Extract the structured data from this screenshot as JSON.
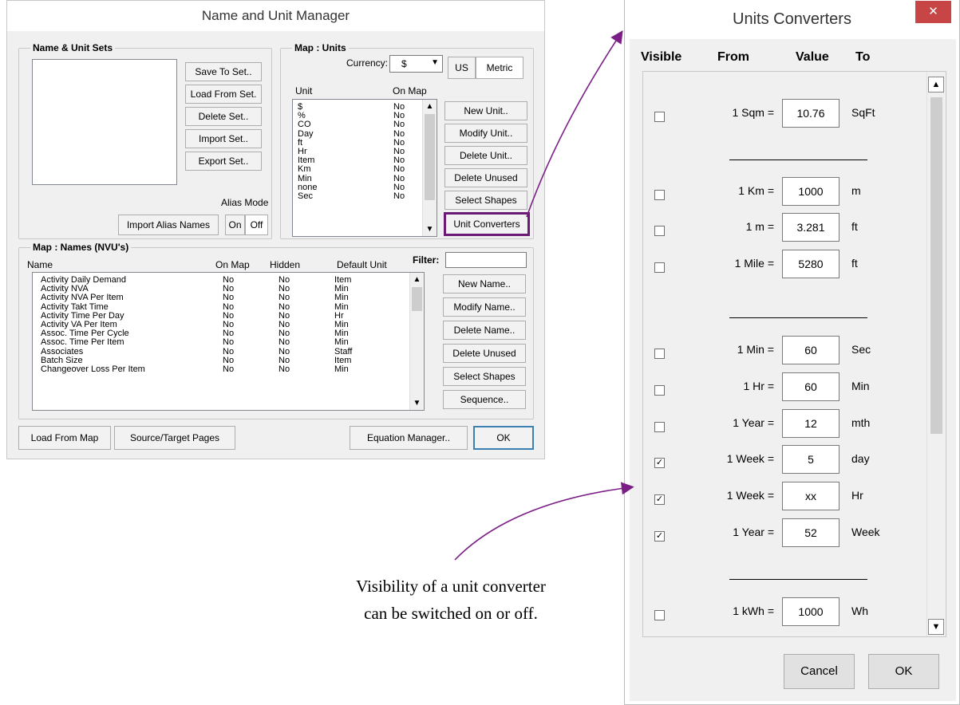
{
  "manager": {
    "title": "Name and Unit Manager",
    "sets": {
      "legend": "Name & Unit Sets",
      "buttons": [
        "Save To Set..",
        "Load From Set.",
        "Delete Set..",
        "Import Set..",
        "Export Set.."
      ],
      "alias_mode_label": "Alias Mode",
      "import_alias": "Import Alias Names",
      "on": "On",
      "off": "Off"
    },
    "units": {
      "legend": "Map : Units",
      "currency_label": "Currency:",
      "currency_value": "$",
      "us": "US",
      "metric": "Metric",
      "col_unit": "Unit",
      "col_onmap": "On Map",
      "rows": [
        [
          "$",
          "No"
        ],
        [
          "%",
          "No"
        ],
        [
          "CO",
          "No"
        ],
        [
          "Day",
          "No"
        ],
        [
          "ft",
          "No"
        ],
        [
          "Hr",
          "No"
        ],
        [
          "Item",
          "No"
        ],
        [
          "Km",
          "No"
        ],
        [
          "Min",
          "No"
        ],
        [
          "none",
          "No"
        ],
        [
          "Sec",
          "No"
        ]
      ],
      "buttons": [
        "New Unit..",
        "Modify Unit..",
        "Delete Unit..",
        "Delete Unused",
        "Select Shapes",
        "Unit Converters"
      ]
    },
    "names": {
      "legend": "Map : Names (NVU's)",
      "col_name": "Name",
      "col_onmap": "On Map",
      "col_hidden": "Hidden",
      "col_default": "Default Unit",
      "filter_label": "Filter:",
      "filter_value": "",
      "rows": [
        [
          "Activity Daily Demand",
          "No",
          "No",
          "Item"
        ],
        [
          "Activity NVA",
          "No",
          "No",
          "Min"
        ],
        [
          "Activity NVA Per Item",
          "No",
          "No",
          "Min"
        ],
        [
          "Activity Takt Time",
          "No",
          "No",
          "Min"
        ],
        [
          "Activity Time Per Day",
          "No",
          "No",
          "Hr"
        ],
        [
          "Activity VA Per Item",
          "No",
          "No",
          "Min"
        ],
        [
          "Assoc. Time Per Cycle",
          "No",
          "No",
          "Min"
        ],
        [
          "Assoc. Time Per Item",
          "No",
          "No",
          "Min"
        ],
        [
          "Associates",
          "No",
          "No",
          "Staff"
        ],
        [
          "Batch Size",
          "No",
          "No",
          "Item"
        ],
        [
          "Changeover Loss Per Item",
          "No",
          "No",
          "Min"
        ]
      ],
      "buttons": [
        "New Name..",
        "Modify Name..",
        "Delete Name..",
        "Delete Unused",
        "Select Shapes",
        "Sequence.."
      ]
    },
    "bottom": {
      "load_from_map": "Load From Map",
      "source_target": "Source/Target Pages",
      "equation_manager": "Equation Manager..",
      "ok": "OK"
    }
  },
  "converters": {
    "title": "Units Converters",
    "close": "✕",
    "headers": {
      "visible": "Visible",
      "from": "From",
      "value": "Value",
      "to": "To"
    },
    "rows": [
      {
        "from": "1 Sqm =",
        "value": "10.76",
        "to": "SqFt",
        "checked": false
      },
      {
        "from": "1 Km =",
        "value": "1000",
        "to": "m",
        "checked": false
      },
      {
        "from": "1 m =",
        "value": "3.281",
        "to": "ft",
        "checked": false
      },
      {
        "from": "1 Mile =",
        "value": "5280",
        "to": "ft",
        "checked": false
      },
      {
        "from": "1 Min =",
        "value": "60",
        "to": "Sec",
        "checked": false
      },
      {
        "from": "1 Hr =",
        "value": "60",
        "to": "Min",
        "checked": false
      },
      {
        "from": "1 Year =",
        "value": "12",
        "to": "mth",
        "checked": false
      },
      {
        "from": "1 Week =",
        "value": "5",
        "to": "day",
        "checked": true
      },
      {
        "from": "1 Week =",
        "value": "xx",
        "to": "Hr",
        "checked": true
      },
      {
        "from": "1 Year =",
        "value": "52",
        "to": "Week",
        "checked": true
      },
      {
        "from": "1 kWh =",
        "value": "1000",
        "to": "Wh",
        "checked": false
      }
    ],
    "cancel": "Cancel",
    "ok": "OK"
  },
  "annotation": {
    "line1": "Visibility of a unit converter",
    "line2": "can be switched on or off.",
    "color": "#7b1f86",
    "highlight_color": "#6b1a75"
  },
  "glyphs": {
    "check": "✓",
    "up": "▲",
    "down": "▼",
    "dropdown": "▼"
  }
}
